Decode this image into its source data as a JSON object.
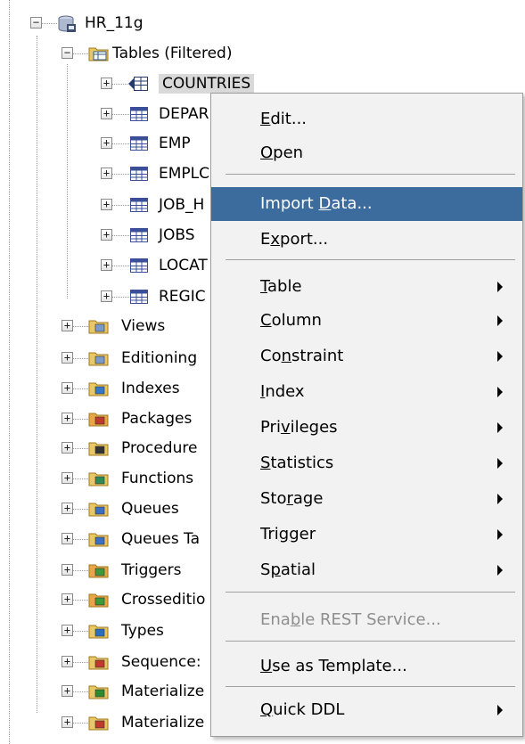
{
  "tree": {
    "connection": "HR_11g",
    "tables_folder": "Tables (Filtered)",
    "tables": [
      "COUNTRIES",
      "DEPAR",
      "EMP",
      "EMPLC",
      "JOB_H",
      "JOBS",
      "LOCAT",
      "REGIC"
    ],
    "folders": [
      "Views",
      "Editioning",
      "Indexes",
      "Packages",
      "Procedure",
      "Functions",
      "Queues",
      "Queues Ta",
      "Triggers",
      "Crosseditio",
      "Types",
      "Sequence:",
      "Materialize",
      "Materialize"
    ]
  },
  "context_menu": {
    "items": [
      {
        "label": "Edit...",
        "mn": 0,
        "submenu": false
      },
      {
        "label": "Open",
        "mn": 0,
        "submenu": false
      },
      {
        "label": "Import Data...",
        "mn": 7,
        "submenu": false,
        "highlighted": true
      },
      {
        "label": "Export...",
        "mn": 1,
        "submenu": false
      },
      {
        "label": "Table",
        "mn": 0,
        "submenu": true
      },
      {
        "label": "Column",
        "mn": 0,
        "submenu": true
      },
      {
        "label": "Constraint",
        "mn": 2,
        "submenu": true
      },
      {
        "label": "Index",
        "mn": 0,
        "submenu": true
      },
      {
        "label": "Privileges",
        "mn": 3,
        "submenu": true
      },
      {
        "label": "Statistics",
        "mn": 0,
        "submenu": true
      },
      {
        "label": "Storage",
        "mn": 3,
        "submenu": true
      },
      {
        "label": "Trigger",
        "mn": 3,
        "submenu": true
      },
      {
        "label": "Spatial",
        "mn": 1,
        "submenu": true
      },
      {
        "label": "Enable REST Service...",
        "mn": 3,
        "submenu": false,
        "disabled": true
      },
      {
        "label": "Use as Template...",
        "mn": 0,
        "submenu": false
      },
      {
        "label": "Quick DDL",
        "mn": 0,
        "submenu": true
      }
    ]
  },
  "colors": {
    "highlight": "#3c6c9d",
    "menu_bg": "#f2f2f2",
    "disabled_text": "#8e8e8e",
    "selection_bg": "#d9d9d9"
  },
  "icons": {
    "connection": "database-connection-icon",
    "tables_folder": "tables-folder-icon",
    "table": "table-grid-icon",
    "selected_table": "table-arrow-icon",
    "folders": [
      "views-icon",
      "editioning-views-icon",
      "indexes-icon",
      "packages-icon",
      "procedures-icon",
      "functions-icon",
      "queues-icon",
      "queue-tables-icon",
      "triggers-icon",
      "crossedition-triggers-icon",
      "types-icon",
      "sequences-icon",
      "materialized-views-icon",
      "materialized-view-logs-icon"
    ]
  }
}
